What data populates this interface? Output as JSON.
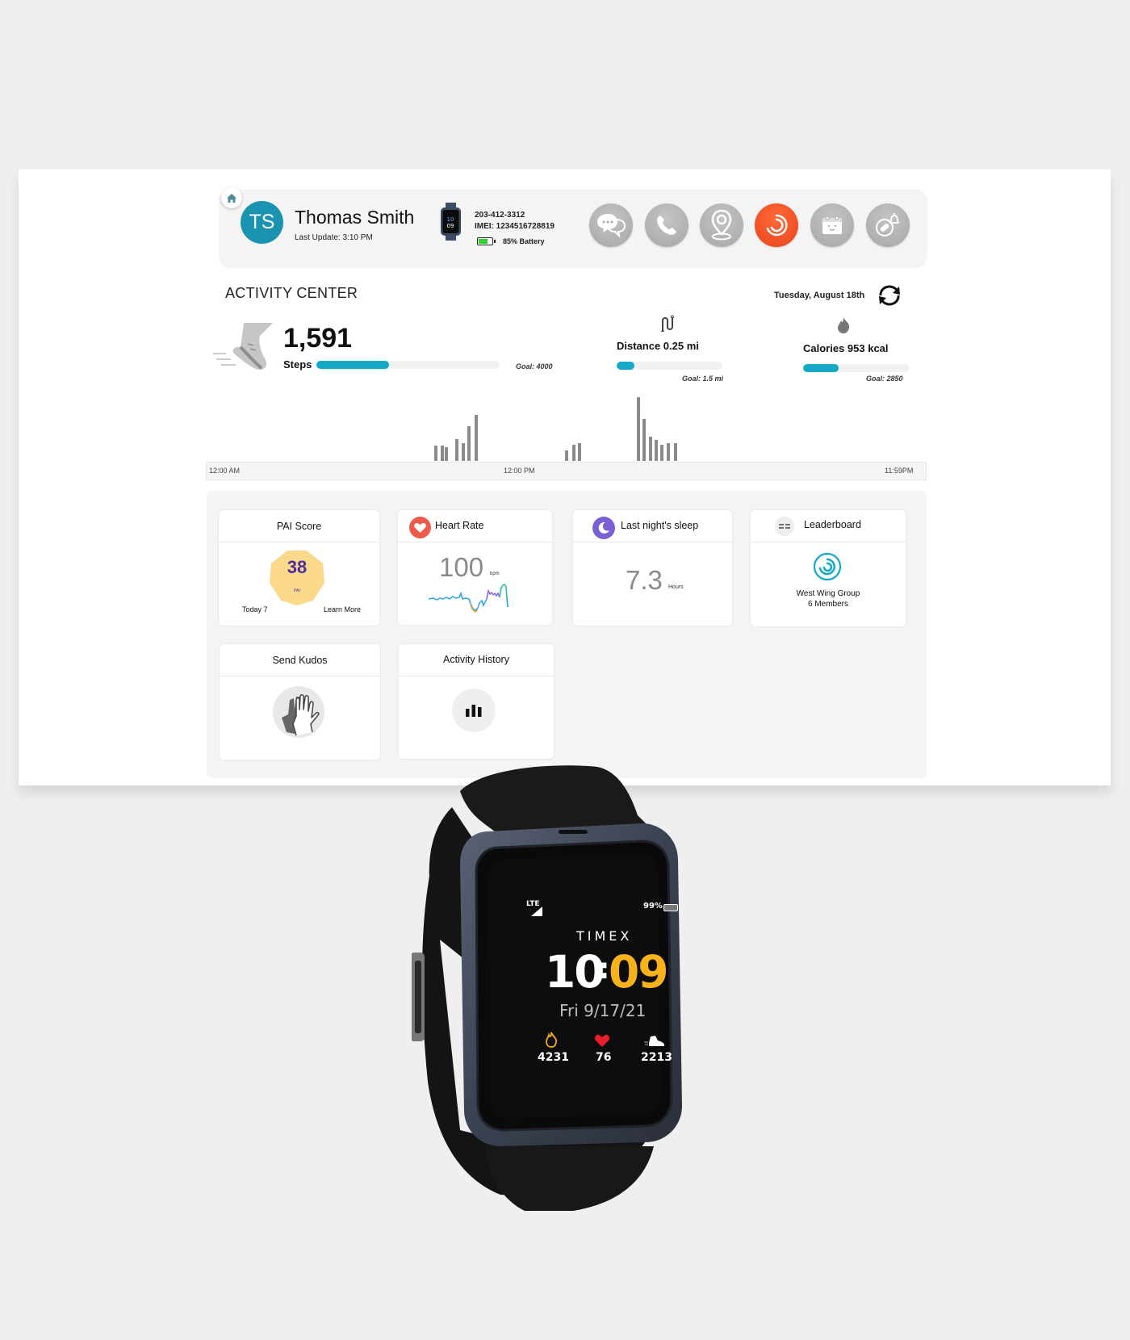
{
  "header": {
    "avatar_initials": "TS",
    "user_name": "Thomas Smith",
    "last_update": "Last Update: 3:10 PM",
    "device_phone": "203-412-3312",
    "device_imei": "IMEI: 1234516728819",
    "battery_percent": 85,
    "battery_label": "85% Battery",
    "actions": [
      {
        "name": "messages",
        "icon": "chat-bubbles-icon",
        "active": false
      },
      {
        "name": "call",
        "icon": "phone-icon",
        "active": false
      },
      {
        "name": "location",
        "icon": "map-pin-icon",
        "active": false
      },
      {
        "name": "activity",
        "icon": "activity-ring-icon",
        "active": true
      },
      {
        "name": "schedule",
        "icon": "calendar-icon",
        "active": false
      },
      {
        "name": "medication-reminder",
        "icon": "pill-bell-icon",
        "active": false
      }
    ]
  },
  "activity": {
    "section_title": "ACTIVITY CENTER",
    "date": "Tuesday, August 18th",
    "steps": {
      "value": "1,591",
      "label": "Steps",
      "current": 1591,
      "goal": 4000,
      "goal_label": "Goal: 4000"
    },
    "distance": {
      "label": "Distance 0.25 mi",
      "current": 0.25,
      "goal": 1.5,
      "goal_label": "Goal: 1.5 mi"
    },
    "calories": {
      "label": "Calories 953 kcal",
      "current": 953,
      "goal": 2850,
      "goal_label": "Goal: 2850"
    }
  },
  "chart_data": {
    "type": "bar",
    "title": "",
    "xlabel": "",
    "ylabel": "",
    "x_tick_labels": [
      "12:00 AM",
      "12:00 PM",
      "11:59PM"
    ],
    "x_range_hours": [
      0,
      24
    ],
    "grid": false,
    "x": [
      7.6,
      7.8,
      7.95,
      8.3,
      8.5,
      8.7,
      8.95,
      11.95,
      12.2,
      12.4,
      14.35,
      14.55,
      14.75,
      14.95,
      15.15,
      15.35,
      15.6
    ],
    "values": [
      19,
      19,
      17,
      27,
      22,
      43,
      57,
      13,
      20,
      22,
      79,
      52,
      30,
      26,
      20,
      22,
      22
    ],
    "value_units": "relative step count (unlabeled axis)"
  },
  "cards": {
    "pai": {
      "title": "PAI Score",
      "score": "38",
      "unit": "PAI",
      "today": "Today 7",
      "learn_more": "Learn More"
    },
    "heart": {
      "title": "Heart Rate",
      "value": "100",
      "unit": "bpm"
    },
    "sleep": {
      "title": "Last night's sleep",
      "value": "7.3",
      "unit": "Hours"
    },
    "leaderboard": {
      "title": "Leaderboard",
      "group": "West Wing Group",
      "members": "6 Members"
    },
    "kudos": {
      "title": "Send Kudos"
    },
    "history": {
      "title": "Activity History"
    }
  },
  "watch": {
    "network": "LTE",
    "battery": "99%",
    "brand": "TIMEX",
    "time_hours": "10",
    "time_minutes": "09",
    "date": "Fri 9/17/21",
    "calories": "4231",
    "heart_rate": "76",
    "steps": "2213"
  },
  "colors": {
    "accent": "#13a9c6",
    "avatar": "#1a93b0",
    "active_action": "#e8431a",
    "pai_purple": "#4a2ea0",
    "pai_hex": "#fbd98a",
    "watch_minutes": "#f6b21a"
  }
}
